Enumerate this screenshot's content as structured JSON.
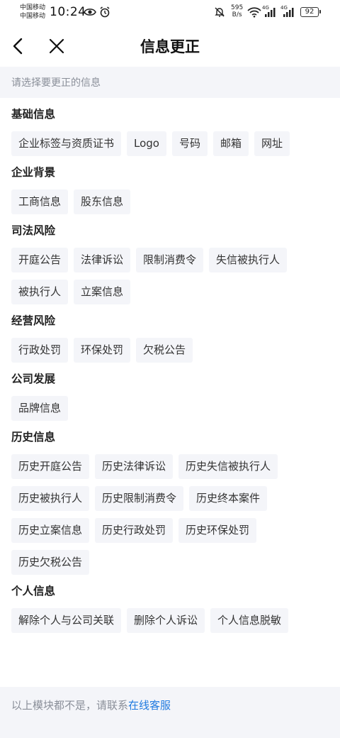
{
  "status_bar": {
    "carrier_1": "中国移动",
    "carrier_2": "中国移动",
    "time": "10:24",
    "net_speed_value": "595",
    "net_speed_unit": "B/s",
    "signal_1_label": "4G",
    "signal_2_label": "4G",
    "battery": "92",
    "icons": [
      "eye-icon",
      "alarm-icon",
      "mute-icon",
      "wifi-icon",
      "signal-icon",
      "battery-icon"
    ]
  },
  "nav": {
    "title": "信息更正",
    "back_icon": "chevron-left-icon",
    "close_icon": "close-icon"
  },
  "hint": "请选择要更正的信息",
  "sections": [
    {
      "title": "基础信息",
      "tags": [
        "企业标签与资质证书",
        "Logo",
        "号码",
        "邮箱",
        "网址"
      ]
    },
    {
      "title": "企业背景",
      "tags": [
        "工商信息",
        "股东信息"
      ]
    },
    {
      "title": "司法风险",
      "tags": [
        "开庭公告",
        "法律诉讼",
        "限制消费令",
        "失信被执行人",
        "被执行人",
        "立案信息"
      ]
    },
    {
      "title": "经营风险",
      "tags": [
        "行政处罚",
        "环保处罚",
        "欠税公告"
      ]
    },
    {
      "title": "公司发展",
      "tags": [
        "品牌信息"
      ]
    },
    {
      "title": "历史信息",
      "tags": [
        "历史开庭公告",
        "历史法律诉讼",
        "历史失信被执行人",
        "历史被执行人",
        "历史限制消费令",
        "历史终本案件",
        "历史立案信息",
        "历史行政处罚",
        "历史环保处罚",
        "历史欠税公告"
      ]
    },
    {
      "title": "个人信息",
      "tags": [
        "解除个人与公司关联",
        "删除个人诉讼",
        "个人信息脱敏"
      ]
    }
  ],
  "footer": {
    "text": "以上模块都不是，请联系",
    "link": "在线客服"
  },
  "colors": {
    "link": "#1f7ae0",
    "tag_bg": "#f4f5f9",
    "page_bg": "#f4f5f9"
  }
}
